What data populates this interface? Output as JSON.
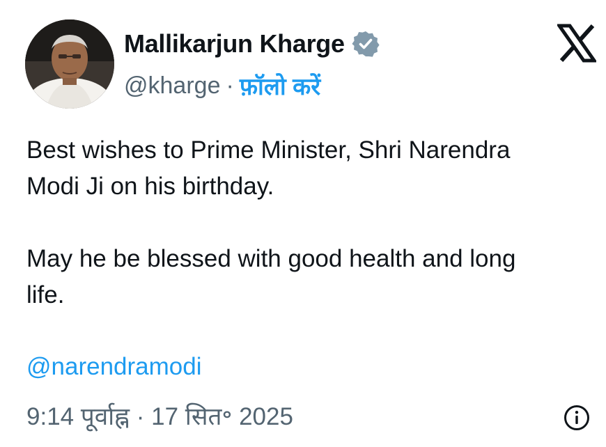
{
  "author": {
    "name": "Mallikarjun Kharge",
    "handle": "@kharge",
    "separator": "·",
    "follow_label": "फ़ॉलो करें",
    "verified_badge_icon": "verified-badge-icon",
    "avatar_icon": "profile-photo"
  },
  "brand": {
    "logo_icon": "x-logo-icon"
  },
  "tweet": {
    "paragraph1_line1": "Best wishes to Prime Minister, Shri Narendra",
    "paragraph1_line2": "Modi Ji on his birthday.",
    "paragraph2_line1": "May he be blessed with good health and long",
    "paragraph2_line2": "life.",
    "mention": "@narendramodi",
    "timestamp": "9:14 पूर्वाह्न · 17 सित॰ 2025"
  },
  "footer": {
    "info_icon": "info-icon"
  },
  "colors": {
    "accent": "#1d9bf0",
    "text": "#0f1419",
    "secondary_text": "#536471",
    "badge": "#829aab"
  }
}
